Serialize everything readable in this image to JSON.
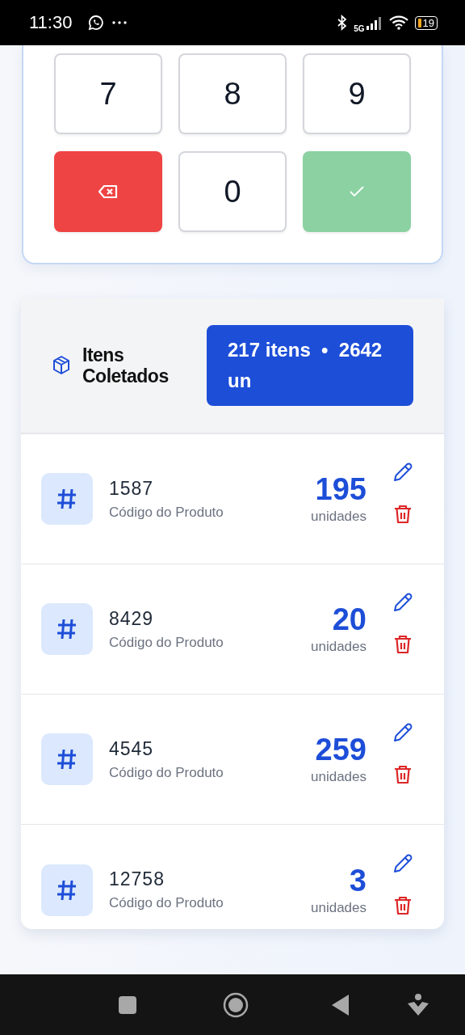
{
  "status_bar": {
    "time": "11:30",
    "network": "5G",
    "battery": "19"
  },
  "keypad": {
    "keys": [
      {
        "kind": "digit",
        "label": "7"
      },
      {
        "kind": "digit",
        "label": "8"
      },
      {
        "kind": "digit",
        "label": "9"
      },
      {
        "kind": "backspace"
      },
      {
        "kind": "digit",
        "label": "0"
      },
      {
        "kind": "confirm"
      }
    ]
  },
  "collected": {
    "title": "Itens Coletados",
    "summary": "217 itens  •  2642 un",
    "items": [
      {
        "code": "1587",
        "label": "Código do Produto",
        "quantity": "195",
        "unit": "unidades"
      },
      {
        "code": "8429",
        "label": "Código do Produto",
        "quantity": "20",
        "unit": "unidades"
      },
      {
        "code": "4545",
        "label": "Código do Produto",
        "quantity": "259",
        "unit": "unidades"
      },
      {
        "code": "12758",
        "label": "Código do Produto",
        "quantity": "3",
        "unit": "unidades"
      }
    ]
  }
}
